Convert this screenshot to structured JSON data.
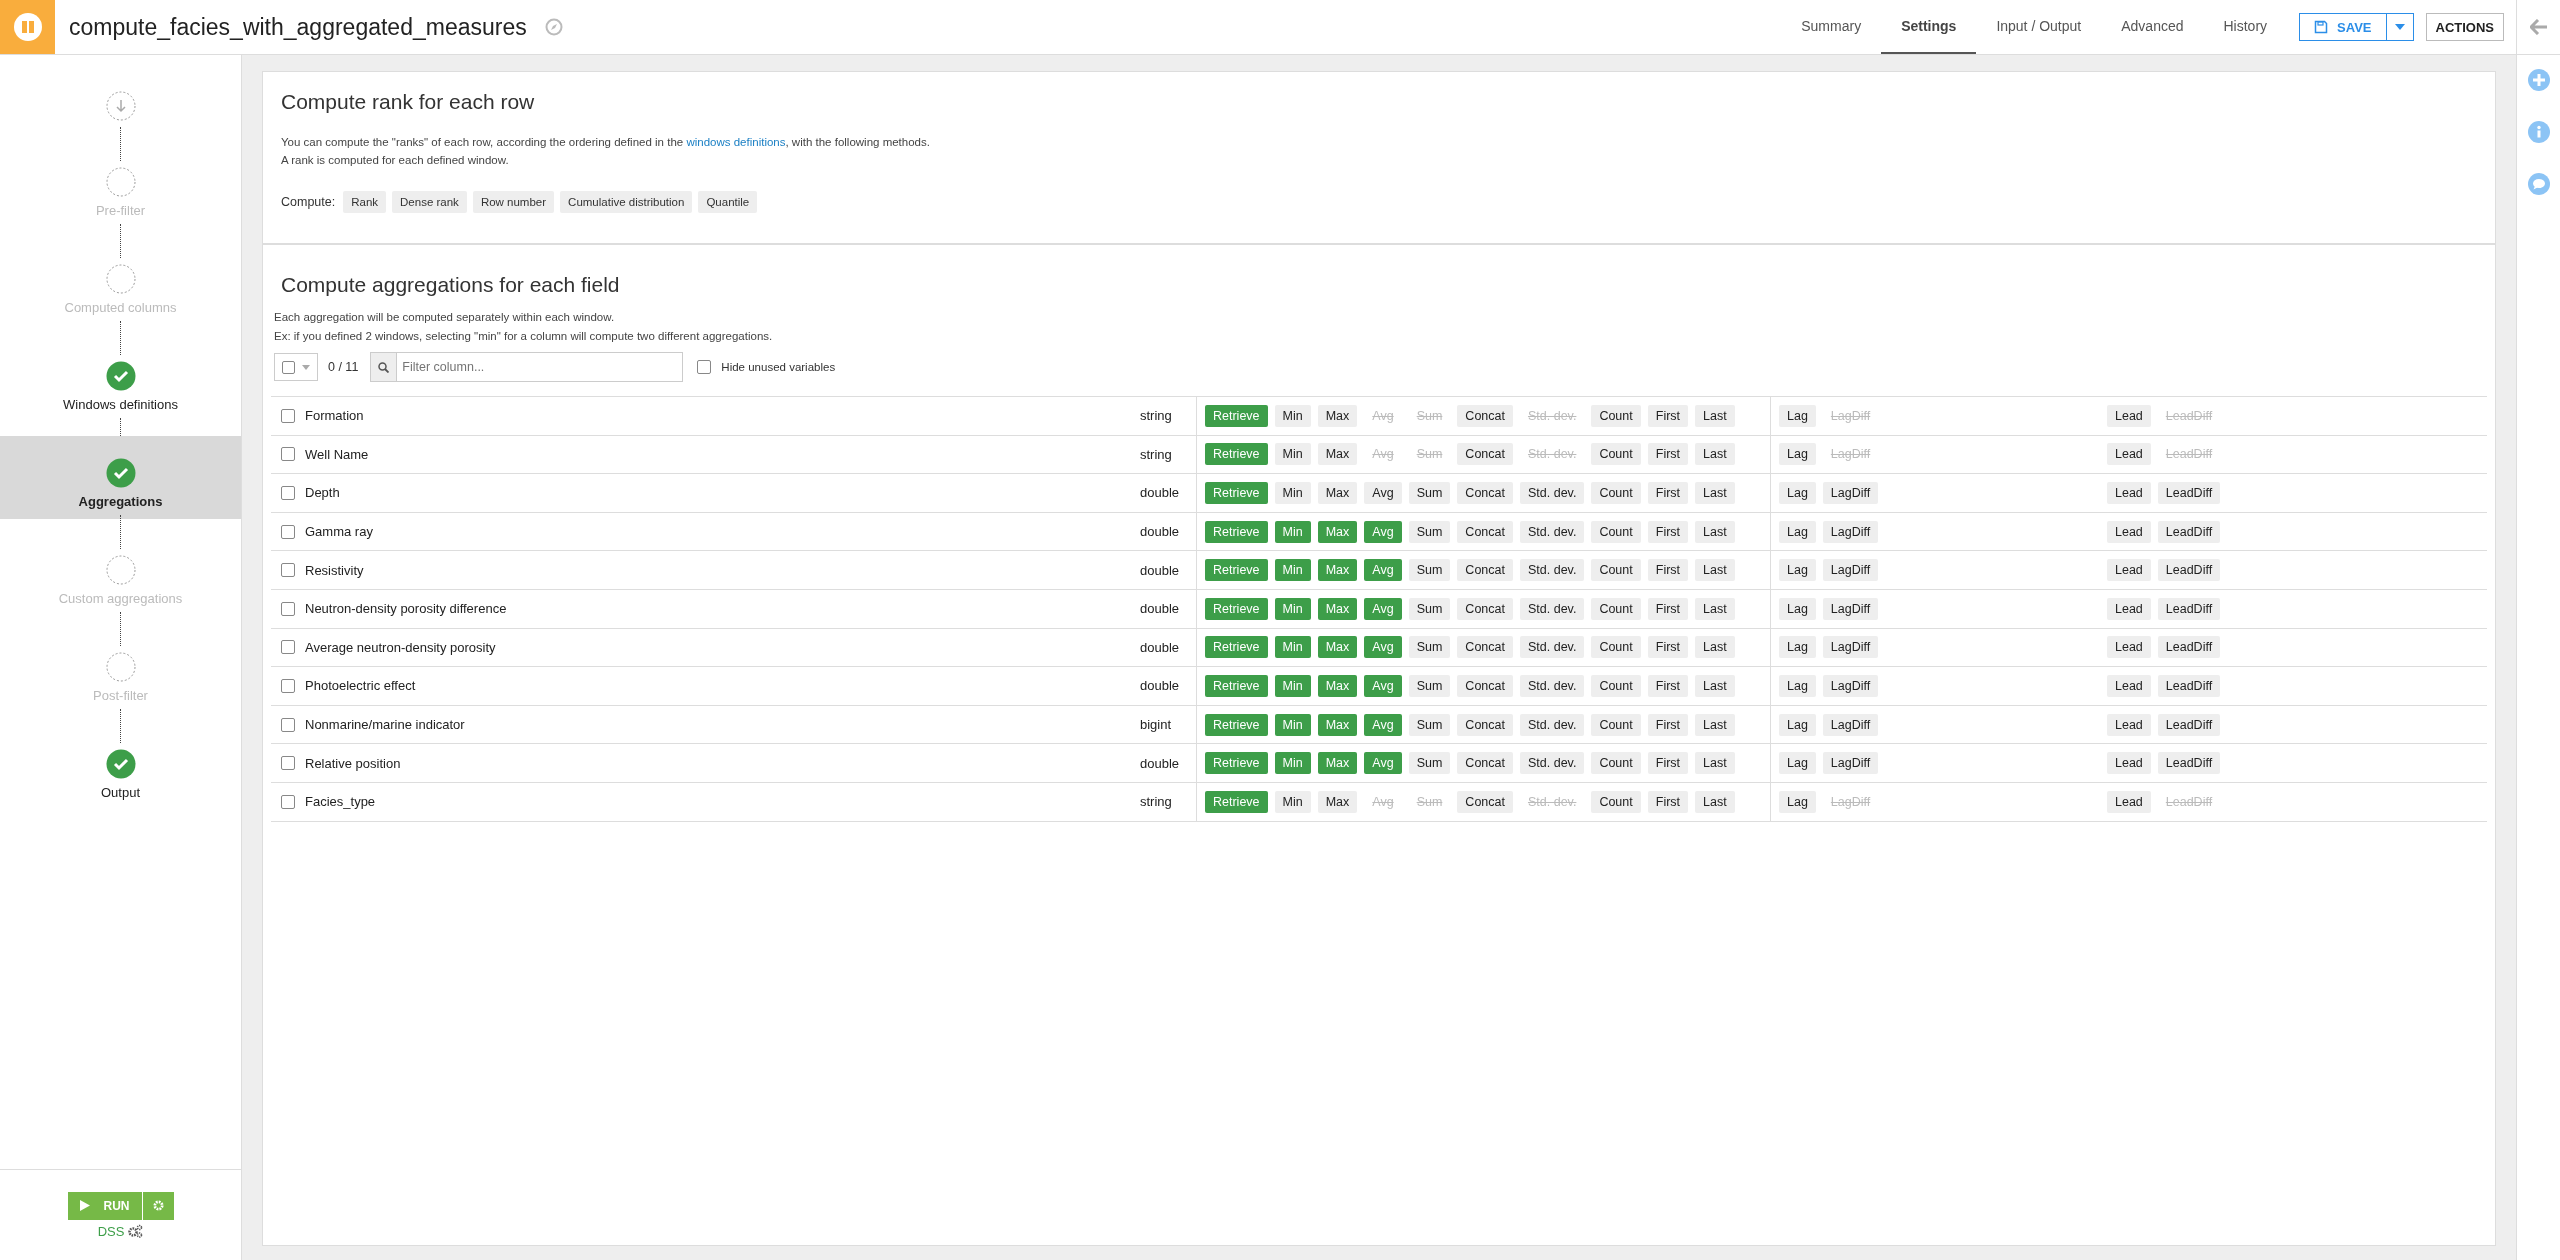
{
  "header": {
    "title": "compute_facies_with_aggregated_measures",
    "tabs": [
      {
        "label": "Summary",
        "selected": false
      },
      {
        "label": "Settings",
        "selected": true
      },
      {
        "label": "Input / Output",
        "selected": false
      },
      {
        "label": "Advanced",
        "selected": false
      },
      {
        "label": "History",
        "selected": false
      }
    ],
    "save": "SAVE",
    "actions": "ACTIONS"
  },
  "steps": [
    {
      "kind": "start",
      "selected": false
    },
    {
      "kind": "step",
      "label": "Pre-filter",
      "done": false,
      "selected": false
    },
    {
      "kind": "step",
      "label": "Computed columns",
      "done": false,
      "selected": false
    },
    {
      "kind": "step",
      "label": "Windows definitions",
      "done": true,
      "selected": false
    },
    {
      "kind": "step",
      "label": "Aggregations",
      "done": true,
      "selected": true
    },
    {
      "kind": "step",
      "label": "Custom aggregations",
      "done": false,
      "selected": false
    },
    {
      "kind": "step",
      "label": "Post-filter",
      "done": false,
      "selected": false
    },
    {
      "kind": "step",
      "label": "Output",
      "done": true,
      "selected": false
    }
  ],
  "run": {
    "label": "RUN",
    "engine": "DSS"
  },
  "rank": {
    "title": "Compute rank for each row",
    "text": "You can compute the \"ranks\" of each row, according the ordering defined in the",
    "link": "windows definitions",
    "text_after": ", with the following methods.",
    "note": "A rank is computed for each defined window.",
    "compute_label": "Compute:",
    "methods": [
      {
        "label": "Rank",
        "selected": false
      },
      {
        "label": "Dense rank",
        "selected": false
      },
      {
        "label": "Row number",
        "selected": false
      },
      {
        "label": "Cumulative distribution",
        "selected": false
      },
      {
        "label": "Quantile",
        "selected": false
      }
    ]
  },
  "aggregations": {
    "title": "Compute aggregations for each field",
    "lines": [
      "Each aggregation will be computed separately within each window.",
      "Ex: if you defined 2 windows, selecting \"min\" for a column will compute two different aggregations."
    ],
    "count": "0 / 11",
    "filter_placeholder": "Filter column...",
    "hide_unused": {
      "label": "Hide unused variables",
      "checked": false
    },
    "rows": [
      {
        "name": "Formation",
        "type": "string",
        "checked": false,
        "main": [
          {
            "label": "Retrieve",
            "selected": true,
            "disabled": false
          },
          {
            "label": "Min",
            "selected": false,
            "disabled": false
          },
          {
            "label": "Max",
            "selected": false,
            "disabled": false
          },
          {
            "label": "Avg",
            "selected": false,
            "disabled": true
          },
          {
            "label": "Sum",
            "selected": false,
            "disabled": true
          },
          {
            "label": "Concat",
            "selected": false,
            "disabled": false
          },
          {
            "label": "Std. dev.",
            "selected": false,
            "disabled": true
          },
          {
            "label": "Count",
            "selected": false,
            "disabled": false
          },
          {
            "label": "First",
            "selected": false,
            "disabled": false
          },
          {
            "label": "Last",
            "selected": false,
            "disabled": false
          }
        ],
        "lag": [
          {
            "label": "Lag",
            "selected": false,
            "disabled": false
          },
          {
            "label": "LagDiff",
            "selected": false,
            "disabled": true
          }
        ],
        "lead": [
          {
            "label": "Lead",
            "selected": false,
            "disabled": false
          },
          {
            "label": "LeadDiff",
            "selected": false,
            "disabled": true
          }
        ]
      },
      {
        "name": "Well Name",
        "type": "string",
        "checked": false,
        "main": [
          {
            "label": "Retrieve",
            "selected": true,
            "disabled": false
          },
          {
            "label": "Min",
            "selected": false,
            "disabled": false
          },
          {
            "label": "Max",
            "selected": false,
            "disabled": false
          },
          {
            "label": "Avg",
            "selected": false,
            "disabled": true
          },
          {
            "label": "Sum",
            "selected": false,
            "disabled": true
          },
          {
            "label": "Concat",
            "selected": false,
            "disabled": false
          },
          {
            "label": "Std. dev.",
            "selected": false,
            "disabled": true
          },
          {
            "label": "Count",
            "selected": false,
            "disabled": false
          },
          {
            "label": "First",
            "selected": false,
            "disabled": false
          },
          {
            "label": "Last",
            "selected": false,
            "disabled": false
          }
        ],
        "lag": [
          {
            "label": "Lag",
            "selected": false,
            "disabled": false
          },
          {
            "label": "LagDiff",
            "selected": false,
            "disabled": true
          }
        ],
        "lead": [
          {
            "label": "Lead",
            "selected": false,
            "disabled": false
          },
          {
            "label": "LeadDiff",
            "selected": false,
            "disabled": true
          }
        ]
      },
      {
        "name": "Depth",
        "type": "double",
        "checked": false,
        "main": [
          {
            "label": "Retrieve",
            "selected": true,
            "disabled": false
          },
          {
            "label": "Min",
            "selected": false,
            "disabled": false
          },
          {
            "label": "Max",
            "selected": false,
            "disabled": false
          },
          {
            "label": "Avg",
            "selected": false,
            "disabled": false
          },
          {
            "label": "Sum",
            "selected": false,
            "disabled": false
          },
          {
            "label": "Concat",
            "selected": false,
            "disabled": false
          },
          {
            "label": "Std. dev.",
            "selected": false,
            "disabled": false
          },
          {
            "label": "Count",
            "selected": false,
            "disabled": false
          },
          {
            "label": "First",
            "selected": false,
            "disabled": false
          },
          {
            "label": "Last",
            "selected": false,
            "disabled": false
          }
        ],
        "lag": [
          {
            "label": "Lag",
            "selected": false,
            "disabled": false
          },
          {
            "label": "LagDiff",
            "selected": false,
            "disabled": false
          }
        ],
        "lead": [
          {
            "label": "Lead",
            "selected": false,
            "disabled": false
          },
          {
            "label": "LeadDiff",
            "selected": false,
            "disabled": false
          }
        ]
      },
      {
        "name": "Gamma ray",
        "type": "double",
        "checked": false,
        "main": [
          {
            "label": "Retrieve",
            "selected": true,
            "disabled": false
          },
          {
            "label": "Min",
            "selected": true,
            "disabled": false
          },
          {
            "label": "Max",
            "selected": true,
            "disabled": false
          },
          {
            "label": "Avg",
            "selected": true,
            "disabled": false
          },
          {
            "label": "Sum",
            "selected": false,
            "disabled": false
          },
          {
            "label": "Concat",
            "selected": false,
            "disabled": false
          },
          {
            "label": "Std. dev.",
            "selected": false,
            "disabled": false
          },
          {
            "label": "Count",
            "selected": false,
            "disabled": false
          },
          {
            "label": "First",
            "selected": false,
            "disabled": false
          },
          {
            "label": "Last",
            "selected": false,
            "disabled": false
          }
        ],
        "lag": [
          {
            "label": "Lag",
            "selected": false,
            "disabled": false
          },
          {
            "label": "LagDiff",
            "selected": false,
            "disabled": false
          }
        ],
        "lead": [
          {
            "label": "Lead",
            "selected": false,
            "disabled": false
          },
          {
            "label": "LeadDiff",
            "selected": false,
            "disabled": false
          }
        ]
      },
      {
        "name": "Resistivity",
        "type": "double",
        "checked": false,
        "main": [
          {
            "label": "Retrieve",
            "selected": true,
            "disabled": false
          },
          {
            "label": "Min",
            "selected": true,
            "disabled": false
          },
          {
            "label": "Max",
            "selected": true,
            "disabled": false
          },
          {
            "label": "Avg",
            "selected": true,
            "disabled": false
          },
          {
            "label": "Sum",
            "selected": false,
            "disabled": false
          },
          {
            "label": "Concat",
            "selected": false,
            "disabled": false
          },
          {
            "label": "Std. dev.",
            "selected": false,
            "disabled": false
          },
          {
            "label": "Count",
            "selected": false,
            "disabled": false
          },
          {
            "label": "First",
            "selected": false,
            "disabled": false
          },
          {
            "label": "Last",
            "selected": false,
            "disabled": false
          }
        ],
        "lag": [
          {
            "label": "Lag",
            "selected": false,
            "disabled": false
          },
          {
            "label": "LagDiff",
            "selected": false,
            "disabled": false
          }
        ],
        "lead": [
          {
            "label": "Lead",
            "selected": false,
            "disabled": false
          },
          {
            "label": "LeadDiff",
            "selected": false,
            "disabled": false
          }
        ]
      },
      {
        "name": "Neutron-density porosity difference",
        "type": "double",
        "checked": false,
        "main": [
          {
            "label": "Retrieve",
            "selected": true,
            "disabled": false
          },
          {
            "label": "Min",
            "selected": true,
            "disabled": false
          },
          {
            "label": "Max",
            "selected": true,
            "disabled": false
          },
          {
            "label": "Avg",
            "selected": true,
            "disabled": false
          },
          {
            "label": "Sum",
            "selected": false,
            "disabled": false
          },
          {
            "label": "Concat",
            "selected": false,
            "disabled": false
          },
          {
            "label": "Std. dev.",
            "selected": false,
            "disabled": false
          },
          {
            "label": "Count",
            "selected": false,
            "disabled": false
          },
          {
            "label": "First",
            "selected": false,
            "disabled": false
          },
          {
            "label": "Last",
            "selected": false,
            "disabled": false
          }
        ],
        "lag": [
          {
            "label": "Lag",
            "selected": false,
            "disabled": false
          },
          {
            "label": "LagDiff",
            "selected": false,
            "disabled": false
          }
        ],
        "lead": [
          {
            "label": "Lead",
            "selected": false,
            "disabled": false
          },
          {
            "label": "LeadDiff",
            "selected": false,
            "disabled": false
          }
        ]
      },
      {
        "name": "Average neutron-density porosity",
        "type": "double",
        "checked": false,
        "main": [
          {
            "label": "Retrieve",
            "selected": true,
            "disabled": false
          },
          {
            "label": "Min",
            "selected": true,
            "disabled": false
          },
          {
            "label": "Max",
            "selected": true,
            "disabled": false
          },
          {
            "label": "Avg",
            "selected": true,
            "disabled": false
          },
          {
            "label": "Sum",
            "selected": false,
            "disabled": false
          },
          {
            "label": "Concat",
            "selected": false,
            "disabled": false
          },
          {
            "label": "Std. dev.",
            "selected": false,
            "disabled": false
          },
          {
            "label": "Count",
            "selected": false,
            "disabled": false
          },
          {
            "label": "First",
            "selected": false,
            "disabled": false
          },
          {
            "label": "Last",
            "selected": false,
            "disabled": false
          }
        ],
        "lag": [
          {
            "label": "Lag",
            "selected": false,
            "disabled": false
          },
          {
            "label": "LagDiff",
            "selected": false,
            "disabled": false
          }
        ],
        "lead": [
          {
            "label": "Lead",
            "selected": false,
            "disabled": false
          },
          {
            "label": "LeadDiff",
            "selected": false,
            "disabled": false
          }
        ]
      },
      {
        "name": "Photoelectric effect",
        "type": "double",
        "checked": false,
        "main": [
          {
            "label": "Retrieve",
            "selected": true,
            "disabled": false
          },
          {
            "label": "Min",
            "selected": true,
            "disabled": false
          },
          {
            "label": "Max",
            "selected": true,
            "disabled": false
          },
          {
            "label": "Avg",
            "selected": true,
            "disabled": false
          },
          {
            "label": "Sum",
            "selected": false,
            "disabled": false
          },
          {
            "label": "Concat",
            "selected": false,
            "disabled": false
          },
          {
            "label": "Std. dev.",
            "selected": false,
            "disabled": false
          },
          {
            "label": "Count",
            "selected": false,
            "disabled": false
          },
          {
            "label": "First",
            "selected": false,
            "disabled": false
          },
          {
            "label": "Last",
            "selected": false,
            "disabled": false
          }
        ],
        "lag": [
          {
            "label": "Lag",
            "selected": false,
            "disabled": false
          },
          {
            "label": "LagDiff",
            "selected": false,
            "disabled": false
          }
        ],
        "lead": [
          {
            "label": "Lead",
            "selected": false,
            "disabled": false
          },
          {
            "label": "LeadDiff",
            "selected": false,
            "disabled": false
          }
        ]
      },
      {
        "name": "Nonmarine/marine indicator",
        "type": "bigint",
        "checked": false,
        "main": [
          {
            "label": "Retrieve",
            "selected": true,
            "disabled": false
          },
          {
            "label": "Min",
            "selected": true,
            "disabled": false
          },
          {
            "label": "Max",
            "selected": true,
            "disabled": false
          },
          {
            "label": "Avg",
            "selected": true,
            "disabled": false
          },
          {
            "label": "Sum",
            "selected": false,
            "disabled": false
          },
          {
            "label": "Concat",
            "selected": false,
            "disabled": false
          },
          {
            "label": "Std. dev.",
            "selected": false,
            "disabled": false
          },
          {
            "label": "Count",
            "selected": false,
            "disabled": false
          },
          {
            "label": "First",
            "selected": false,
            "disabled": false
          },
          {
            "label": "Last",
            "selected": false,
            "disabled": false
          }
        ],
        "lag": [
          {
            "label": "Lag",
            "selected": false,
            "disabled": false
          },
          {
            "label": "LagDiff",
            "selected": false,
            "disabled": false
          }
        ],
        "lead": [
          {
            "label": "Lead",
            "selected": false,
            "disabled": false
          },
          {
            "label": "LeadDiff",
            "selected": false,
            "disabled": false
          }
        ]
      },
      {
        "name": "Relative position",
        "type": "double",
        "checked": false,
        "main": [
          {
            "label": "Retrieve",
            "selected": true,
            "disabled": false
          },
          {
            "label": "Min",
            "selected": true,
            "disabled": false
          },
          {
            "label": "Max",
            "selected": true,
            "disabled": false
          },
          {
            "label": "Avg",
            "selected": true,
            "disabled": false
          },
          {
            "label": "Sum",
            "selected": false,
            "disabled": false
          },
          {
            "label": "Concat",
            "selected": false,
            "disabled": false
          },
          {
            "label": "Std. dev.",
            "selected": false,
            "disabled": false
          },
          {
            "label": "Count",
            "selected": false,
            "disabled": false
          },
          {
            "label": "First",
            "selected": false,
            "disabled": false
          },
          {
            "label": "Last",
            "selected": false,
            "disabled": false
          }
        ],
        "lag": [
          {
            "label": "Lag",
            "selected": false,
            "disabled": false
          },
          {
            "label": "LagDiff",
            "selected": false,
            "disabled": false
          }
        ],
        "lead": [
          {
            "label": "Lead",
            "selected": false,
            "disabled": false
          },
          {
            "label": "LeadDiff",
            "selected": false,
            "disabled": false
          }
        ]
      },
      {
        "name": "Facies_type",
        "type": "string",
        "checked": false,
        "main": [
          {
            "label": "Retrieve",
            "selected": true,
            "disabled": false
          },
          {
            "label": "Min",
            "selected": false,
            "disabled": false
          },
          {
            "label": "Max",
            "selected": false,
            "disabled": false
          },
          {
            "label": "Avg",
            "selected": false,
            "disabled": true
          },
          {
            "label": "Sum",
            "selected": false,
            "disabled": true
          },
          {
            "label": "Concat",
            "selected": false,
            "disabled": false
          },
          {
            "label": "Std. dev.",
            "selected": false,
            "disabled": true
          },
          {
            "label": "Count",
            "selected": false,
            "disabled": false
          },
          {
            "label": "First",
            "selected": false,
            "disabled": false
          },
          {
            "label": "Last",
            "selected": false,
            "disabled": false
          }
        ],
        "lag": [
          {
            "label": "Lag",
            "selected": false,
            "disabled": false
          },
          {
            "label": "LagDiff",
            "selected": false,
            "disabled": true
          }
        ],
        "lead": [
          {
            "label": "Lead",
            "selected": false,
            "disabled": false
          },
          {
            "label": "LeadDiff",
            "selected": false,
            "disabled": true
          }
        ]
      }
    ]
  }
}
